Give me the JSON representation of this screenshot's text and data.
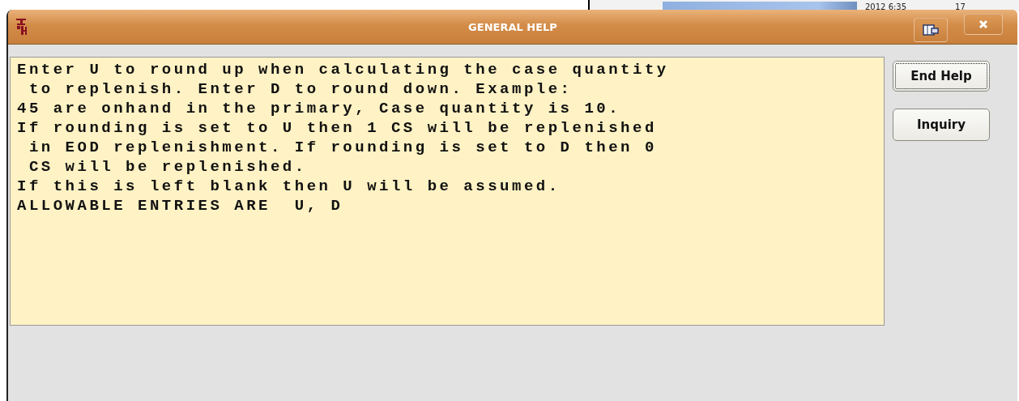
{
  "background": {
    "clock": "2012 6:35",
    "column": "17"
  },
  "window": {
    "title": "GENERAL HELP"
  },
  "help_text": {
    "lines": [
      "Enter U to round up when calculating the case quantity",
      " to replenish. Enter D to round down. Example:",
      "45 are onhand in the primary, Case quantity is 10.",
      "If rounding is set to U then 1 CS will be replenished",
      " in EOD replenishment. If rounding is set to D then 0",
      " CS will be replenished.",
      "If this is left blank then U will be assumed.",
      "ALLOWABLE ENTRIES ARE  U, D"
    ]
  },
  "buttons": [
    {
      "label": "End Help",
      "focused": true
    },
    {
      "label": "Inquiry",
      "focused": false
    }
  ]
}
